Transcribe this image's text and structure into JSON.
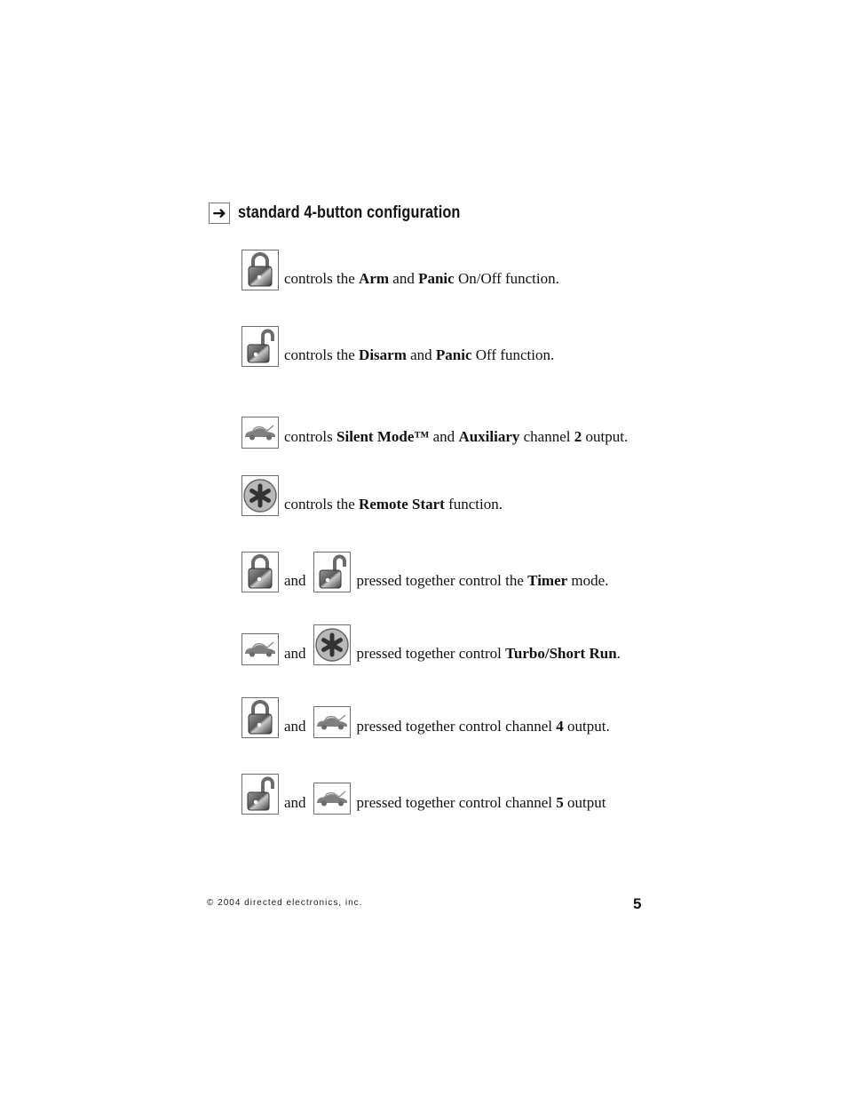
{
  "heading": {
    "icon": "arrow-right-icon",
    "icon_glyph": "➜",
    "title": "standard 4-button configuration"
  },
  "icons": {
    "lock": "lock-closed-icon",
    "unlock": "lock-open-icon",
    "car": "car-trunk-icon",
    "star": "asterisk-icon"
  },
  "rows": [
    {
      "buttons": [
        "lock"
      ],
      "parts": [
        {
          "t": "controls the "
        },
        {
          "t": "Arm",
          "b": true
        },
        {
          "t": " and "
        },
        {
          "t": "Panic",
          "b": true
        },
        {
          "t": " On/Off function."
        }
      ]
    },
    {
      "buttons": [
        "unlock"
      ],
      "parts": [
        {
          "t": "controls the "
        },
        {
          "t": "Disarm",
          "b": true
        },
        {
          "t": " and "
        },
        {
          "t": "Panic",
          "b": true
        },
        {
          "t": " Off function."
        }
      ]
    },
    {
      "buttons": [
        "car"
      ],
      "parts": [
        {
          "t": "controls "
        },
        {
          "t": "Silent Mode™",
          "b": true
        },
        {
          "t": " and "
        },
        {
          "t": "Auxiliary",
          "b": true
        },
        {
          "t": " channel "
        },
        {
          "t": "2",
          "b": true
        },
        {
          "t": " output."
        }
      ]
    },
    {
      "buttons": [
        "star"
      ],
      "parts": [
        {
          "t": "controls the "
        },
        {
          "t": "Remote Start",
          "b": true
        },
        {
          "t": " function."
        }
      ]
    },
    {
      "buttons": [
        "lock",
        "unlock"
      ],
      "connector": "and",
      "parts": [
        {
          "t": "pressed together control the "
        },
        {
          "t": "Timer",
          "b": true
        },
        {
          "t": " mode."
        }
      ]
    },
    {
      "buttons": [
        "car",
        "star"
      ],
      "connector": "and",
      "parts": [
        {
          "t": "pressed together control "
        },
        {
          "t": "Turbo/Short Run",
          "b": true
        },
        {
          "t": "."
        }
      ]
    },
    {
      "buttons": [
        "lock",
        "car"
      ],
      "connector": "and",
      "parts": [
        {
          "t": "pressed together control channel "
        },
        {
          "t": "4",
          "b": true
        },
        {
          "t": " output."
        }
      ]
    },
    {
      "buttons": [
        "unlock",
        "car"
      ],
      "connector": "and",
      "parts": [
        {
          "t": "pressed together control channel "
        },
        {
          "t": "5",
          "b": true
        },
        {
          "t": " output"
        }
      ]
    }
  ],
  "footer": {
    "copyright": "© 2004 directed electronics, inc.",
    "page_number": "5"
  }
}
